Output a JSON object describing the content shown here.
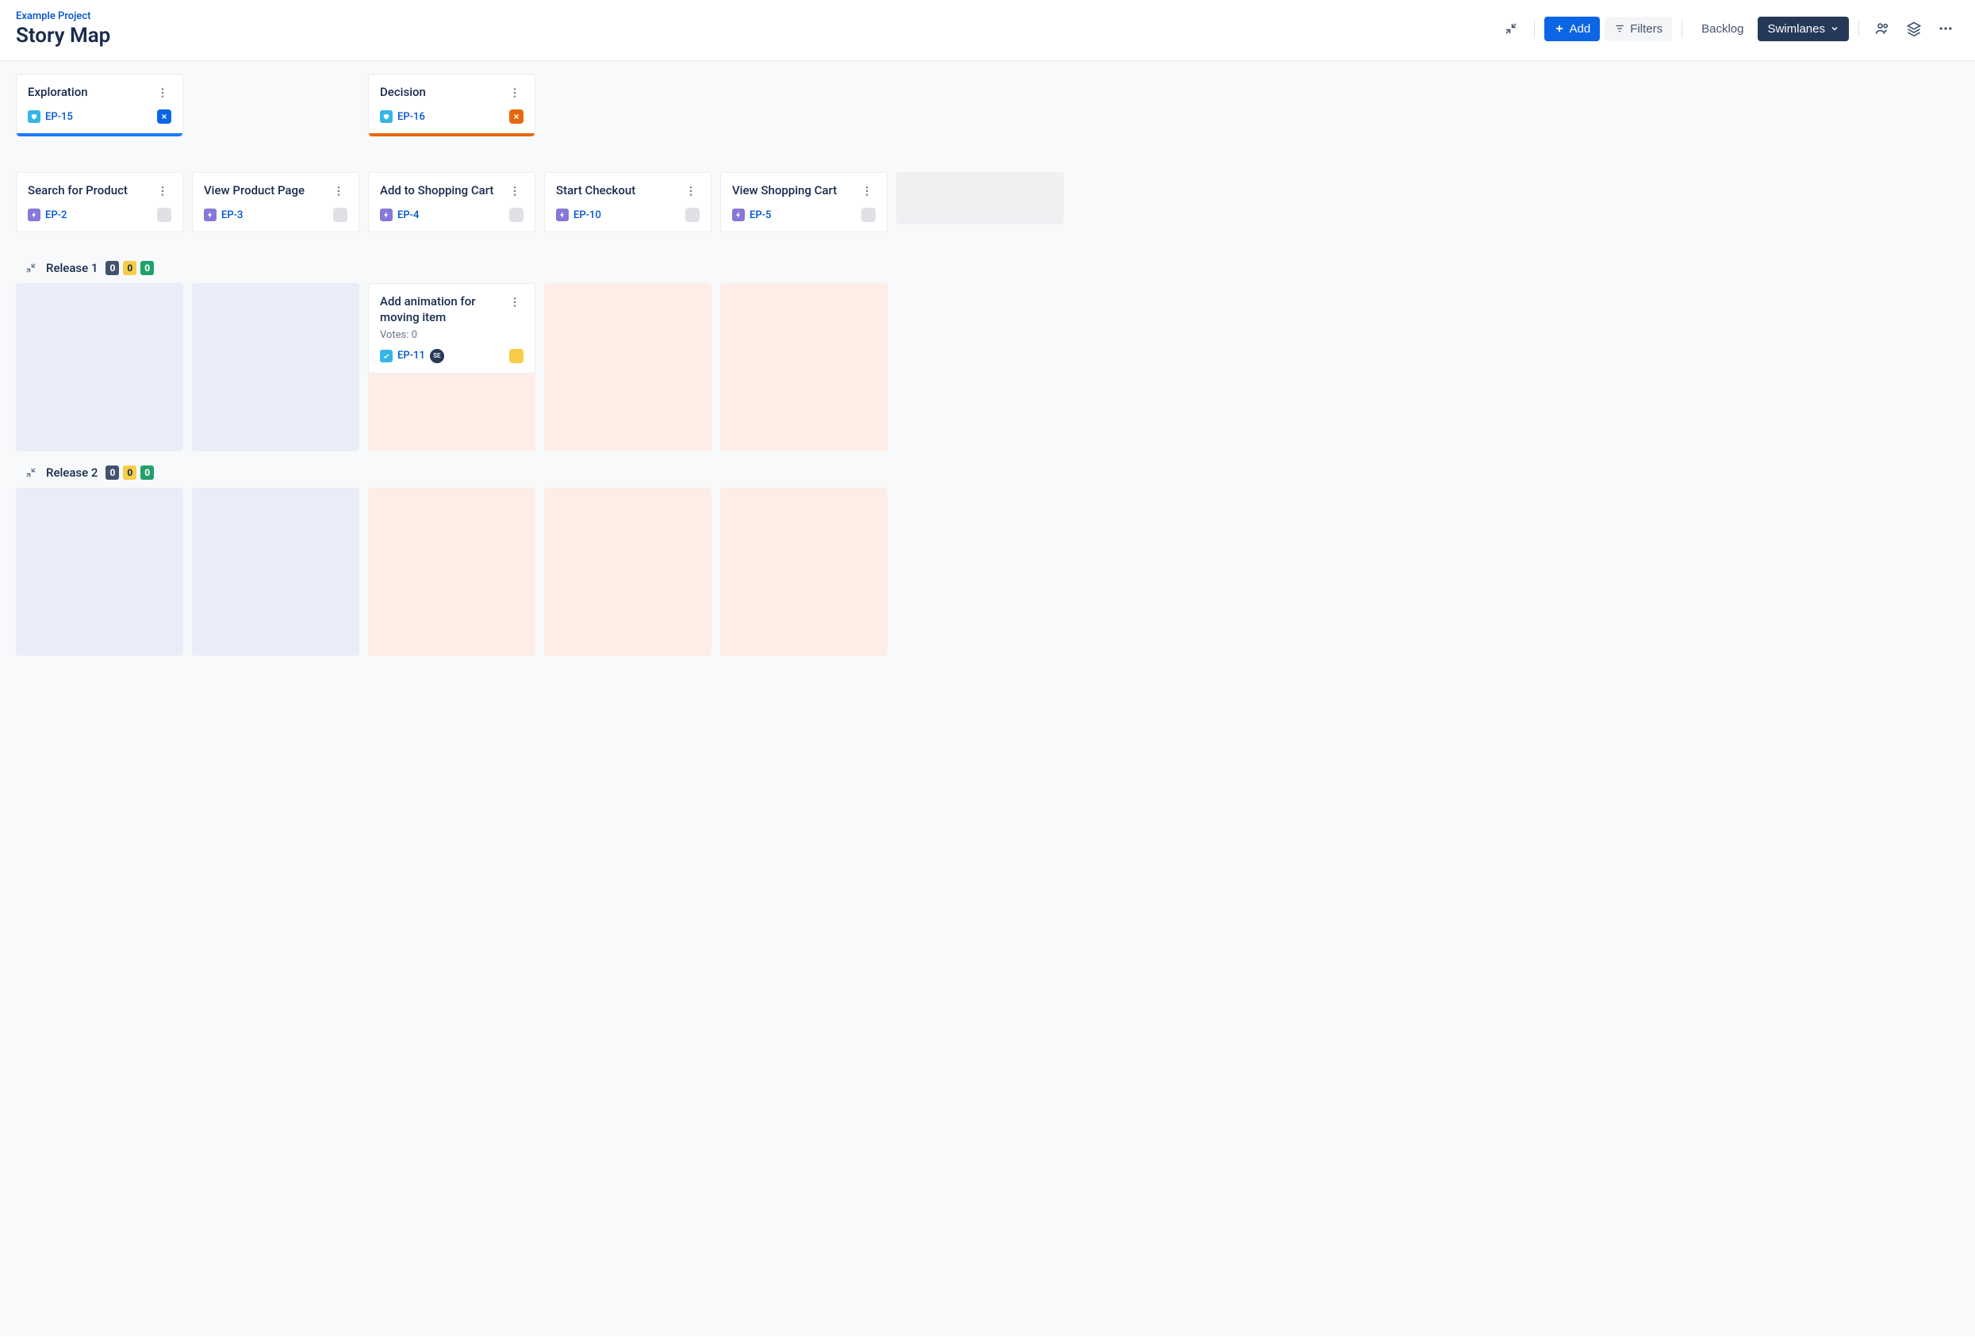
{
  "header": {
    "project_link": "Example Project",
    "page_title": "Story Map",
    "add_label": "Add",
    "filters_label": "Filters",
    "backlog_label": "Backlog",
    "swimlanes_label": "Swimlanes"
  },
  "goals": [
    {
      "title": "Exploration",
      "key": "EP-15",
      "stripe": "blue"
    },
    {
      "title": "Decision",
      "key": "EP-16",
      "stripe": "orange"
    }
  ],
  "steps": [
    {
      "title": "Search for Product",
      "key": "EP-2"
    },
    {
      "title": "View Product Page",
      "key": "EP-3"
    },
    {
      "title": "Add to Shopping Cart",
      "key": "EP-4"
    },
    {
      "title": "Start Checkout",
      "key": "EP-10"
    },
    {
      "title": "View Shopping Cart",
      "key": "EP-5"
    }
  ],
  "lanes": [
    {
      "title": "Release 1",
      "badges": [
        "0",
        "0",
        "0"
      ],
      "cells": [
        {
          "bg": "blue"
        },
        {
          "bg": "blue"
        },
        {
          "bg": "orange",
          "card": {
            "title": "Add animation for moving item",
            "votes": "Votes: 0",
            "key": "EP-11",
            "avatar": "SE"
          }
        },
        {
          "bg": "orange"
        },
        {
          "bg": "orange"
        }
      ]
    },
    {
      "title": "Release 2",
      "badges": [
        "0",
        "0",
        "0"
      ],
      "cells": [
        {
          "bg": "blue"
        },
        {
          "bg": "blue"
        },
        {
          "bg": "orange"
        },
        {
          "bg": "orange"
        },
        {
          "bg": "orange"
        }
      ]
    }
  ]
}
